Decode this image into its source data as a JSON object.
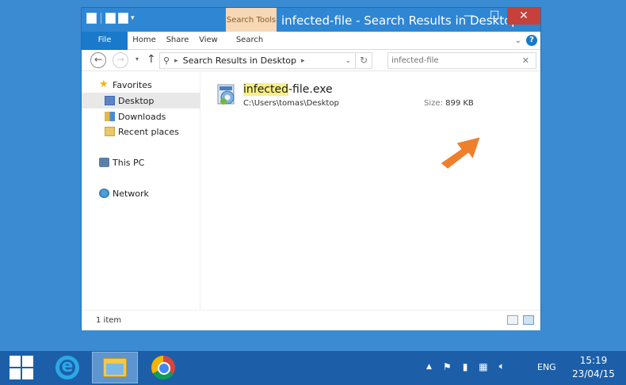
{
  "window": {
    "title": "infected-file - Search Results in Desktop",
    "context_tab": "Search Tools",
    "buttons": {
      "minimize": "—",
      "maximize": "☐",
      "close": "✕"
    }
  },
  "ribbon": {
    "tabs": [
      "File",
      "Home",
      "Share",
      "View",
      "Search"
    ],
    "help": "?"
  },
  "address": {
    "back": "←",
    "forward": "→",
    "up": "↑",
    "path": "Search Results in Desktop",
    "refresh": "↻"
  },
  "search": {
    "value": "infected-file",
    "clear": "✕"
  },
  "sidebar": {
    "items": [
      {
        "label": "Favorites",
        "icon": "star-icon"
      },
      {
        "label": "Desktop",
        "icon": "desktop-folder-icon",
        "selected": true
      },
      {
        "label": "Downloads",
        "icon": "downloads-icon"
      },
      {
        "label": "Recent places",
        "icon": "recent-places-icon"
      },
      {
        "label": "This PC",
        "icon": "computer-icon"
      },
      {
        "label": "Network",
        "icon": "network-icon"
      }
    ]
  },
  "result": {
    "name_highlight": "infected",
    "name_rest": "-file.exe",
    "path": "C:\\Users\\tomas\\Desktop",
    "size_label": "Size:",
    "size_value": "899 KB"
  },
  "status": {
    "count": "1 item"
  },
  "taskbar": {
    "tray_lang": "ENG",
    "time": "15:19",
    "date": "23/04/15"
  },
  "colors": {
    "desktop": "#3b8bd3",
    "window_frame": "#2f86d3",
    "close_button": "#c7403a",
    "context_tab": "#f6d8b6",
    "highlight": "#f8ef86",
    "arrow": "#f07f2c",
    "taskbar": "#1c5fa8"
  }
}
